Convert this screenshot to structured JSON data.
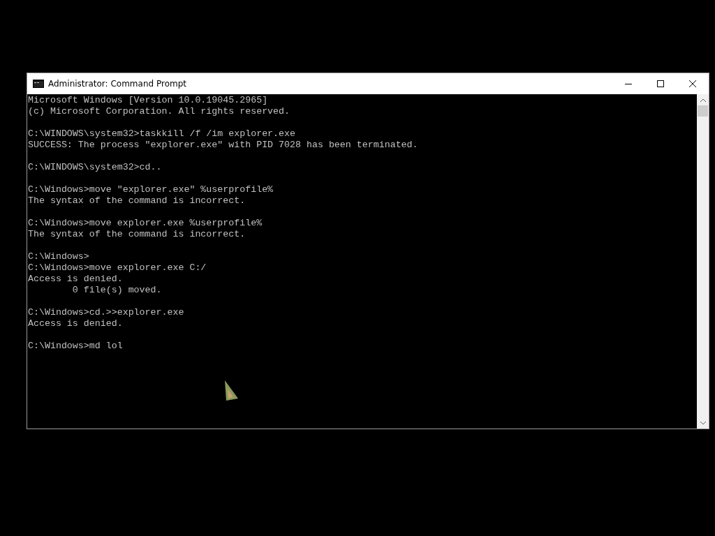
{
  "window": {
    "title": "Administrator: Command Prompt"
  },
  "console": {
    "blocks": [
      [
        "Microsoft Windows [Version 10.0.19045.2965]",
        "(c) Microsoft Corporation. All rights reserved."
      ],
      [
        "C:\\WINDOWS\\system32>taskkill /f /im explorer.exe",
        "SUCCESS: The process \"explorer.exe\" with PID 7028 has been terminated."
      ],
      [
        "C:\\WINDOWS\\system32>cd.."
      ],
      [
        "C:\\Windows>move \"explorer.exe\" %userprofile%",
        "The syntax of the command is incorrect."
      ],
      [
        "C:\\Windows>move explorer.exe %userprofile%",
        "The syntax of the command is incorrect."
      ],
      [
        "C:\\Windows>",
        "C:\\Windows>move explorer.exe C:/",
        "Access is denied.",
        "        0 file(s) moved."
      ],
      [
        "C:\\Windows>cd.>>explorer.exe",
        "Access is denied."
      ],
      [
        "C:\\Windows>md lol"
      ]
    ]
  }
}
